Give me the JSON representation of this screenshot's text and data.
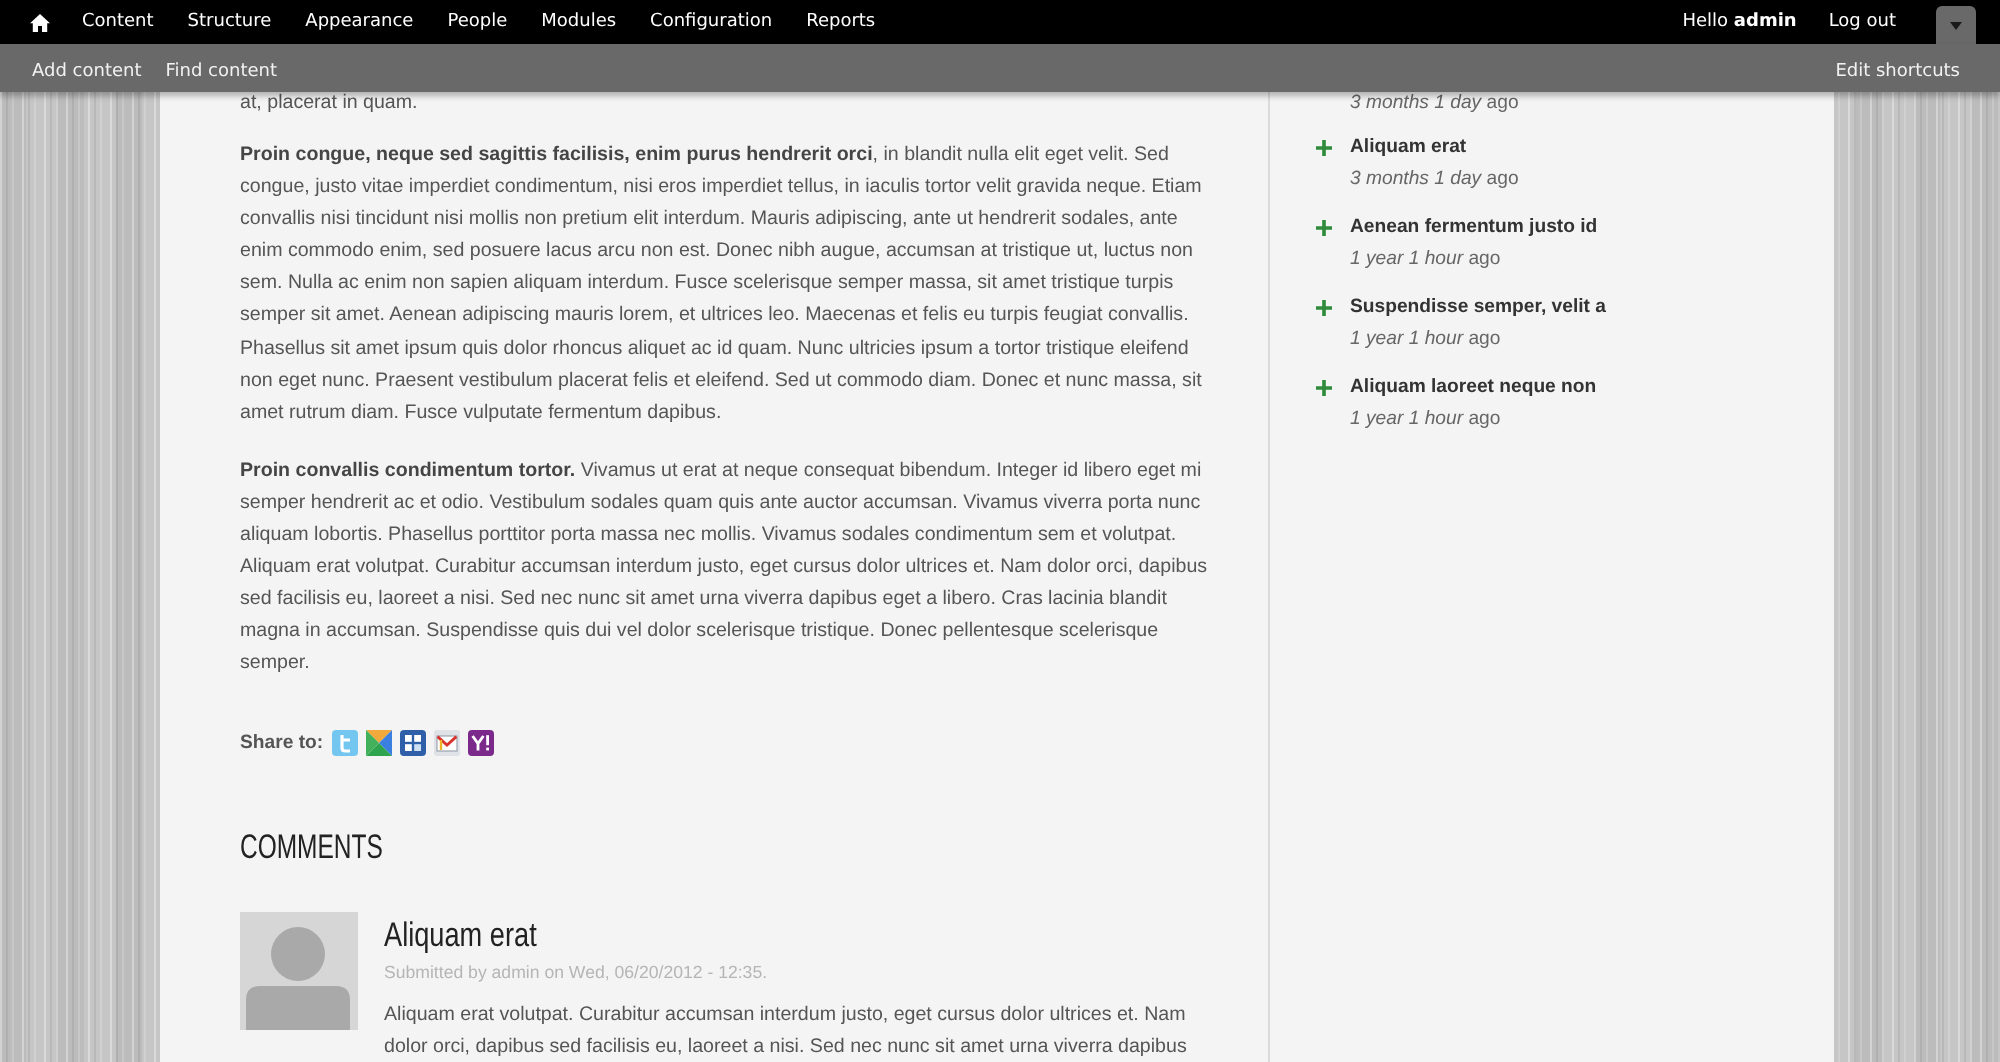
{
  "toolbar": {
    "menu": [
      {
        "label": "Content"
      },
      {
        "label": "Structure"
      },
      {
        "label": "Appearance"
      },
      {
        "label": "People"
      },
      {
        "label": "Modules"
      },
      {
        "label": "Configuration"
      },
      {
        "label": "Reports"
      }
    ],
    "greeting": "Hello **admin**",
    "logout": "Log out"
  },
  "shortcuts": {
    "links": [
      "Add content",
      "Find content"
    ],
    "edit": "Edit shortcuts"
  },
  "article": {
    "cut_line": "at, placerat in quam.",
    "paragraphs": [
      "**Proin congue, neque sed sagittis facilisis, enim purus hendrerit orci**, in blandit nulla elit eget velit. Sed congue, justo vitae imperdiet condimentum, nisi eros imperdiet tellus, in iaculis tortor velit gravida neque. Etiam convallis nisi tincidunt nisi mollis non pretium elit interdum. Mauris adipiscing, ante ut hendrerit sodales, ante enim commodo enim, sed posuere lacus arcu non est. Donec nibh augue, accumsan at tristique ut, luctus non sem. Nulla ac enim non sapien aliquam interdum. Fusce scelerisque semper massa, sit amet tristique turpis semper sit amet. Aenean adipiscing mauris lorem, et ultrices leo. Maecenas et felis eu turpis feugiat convallis. Phasellus sit amet ipsum quis dolor rhoncus aliquet ac id quam. Nunc ultricies ipsum a tortor tristique eleifend non eget nunc. Praesent vestibulum placerat felis et eleifend. Sed ut commodo diam. Donec et nunc massa, sit amet rutrum diam. Fusce vulputate fermentum dapibus.",
      "**Proin convallis condimentum tortor.** Vivamus ut erat at neque consequat bibendum. Integer id libero eget mi semper hendrerit ac et odio. Vestibulum sodales quam quis ante auctor accumsan. Vivamus viverra porta nunc aliquam lobortis. Phasellus porttitor porta massa nec mollis. Vivamus sodales condimentum sem et volutpat. Aliquam erat volutpat. Curabitur accumsan interdum justo, eget cursus dolor ultrices et. Nam dolor orci, dapibus sed facilisis eu, laoreet a nisi. Sed nec nunc sit amet urna viverra dapibus eget a libero. Cras lacinia blandit magna in accumsan. Suspendisse quis dui vel dolor scelerisque tristique. Donec pellentesque scelerisque semper."
    ],
    "share": {
      "label": "Share to:",
      "services": [
        {
          "kind": "t"
        },
        {
          "kind": "triangles"
        },
        {
          "kind": "squares"
        },
        {
          "kind": "envelope"
        },
        {
          "kind": "y"
        }
      ]
    }
  },
  "comments": {
    "heading": "COMMENTS",
    "items": [
      {
        "title": "Aliquam erat",
        "meta": "Submitted by admin on Wed, 06/20/2012 - 12:35.",
        "body": "Aliquam erat volutpat. Curabitur accumsan interdum justo, eget cursus dolor ultrices et. Nam dolor orci, dapibus sed facilisis eu, laoreet a nisi. Sed nec nunc sit amet urna viverra dapibus"
      }
    ]
  },
  "sidebar": {
    "items": [
      {
        "date": "*3 months 1 day* ago"
      },
      {
        "title": "Aliquam erat",
        "date": "*3 months 1 day* ago"
      },
      {
        "title": "Aenean fermentum justo id",
        "date": "*1 year 1 hour* ago"
      },
      {
        "title": "Suspendisse semper, velit a",
        "date": "*1 year 1 hour* ago"
      },
      {
        "title": "Aliquam laoreet neque non",
        "date": "*1 year 1 hour* ago"
      }
    ]
  }
}
